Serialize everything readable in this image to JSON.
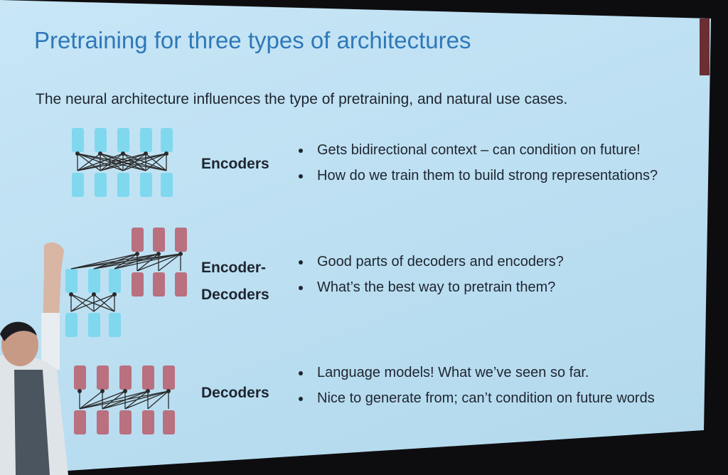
{
  "slide": {
    "title": "Pretraining for three types of architectures",
    "subtitle": "The neural architecture influences the type of pretraining, and natural use cases."
  },
  "rows": [
    {
      "label_lines": [
        "Encoders"
      ],
      "bullets": [
        "Gets bidirectional context – can condition on future!",
        "How do we train them to build strong representations?"
      ],
      "icon": "encoder-diagram-icon"
    },
    {
      "label_lines": [
        "Encoder-",
        "Decoders"
      ],
      "bullets": [
        "Good parts of decoders and encoders?",
        "What’s the best way to pretrain them?"
      ],
      "icon": "encoder-decoder-diagram-icon"
    },
    {
      "label_lines": [
        "Decoders"
      ],
      "bullets": [
        "Language models! What we’ve seen so far.",
        "Nice to generate from; can’t condition on future words"
      ],
      "icon": "decoder-diagram-icon"
    }
  ],
  "colors": {
    "title": "#2f78b8",
    "encoder_block": "#7fd8ee",
    "decoder_block": "#b9707f",
    "screen_background": "#c3e3f4"
  }
}
